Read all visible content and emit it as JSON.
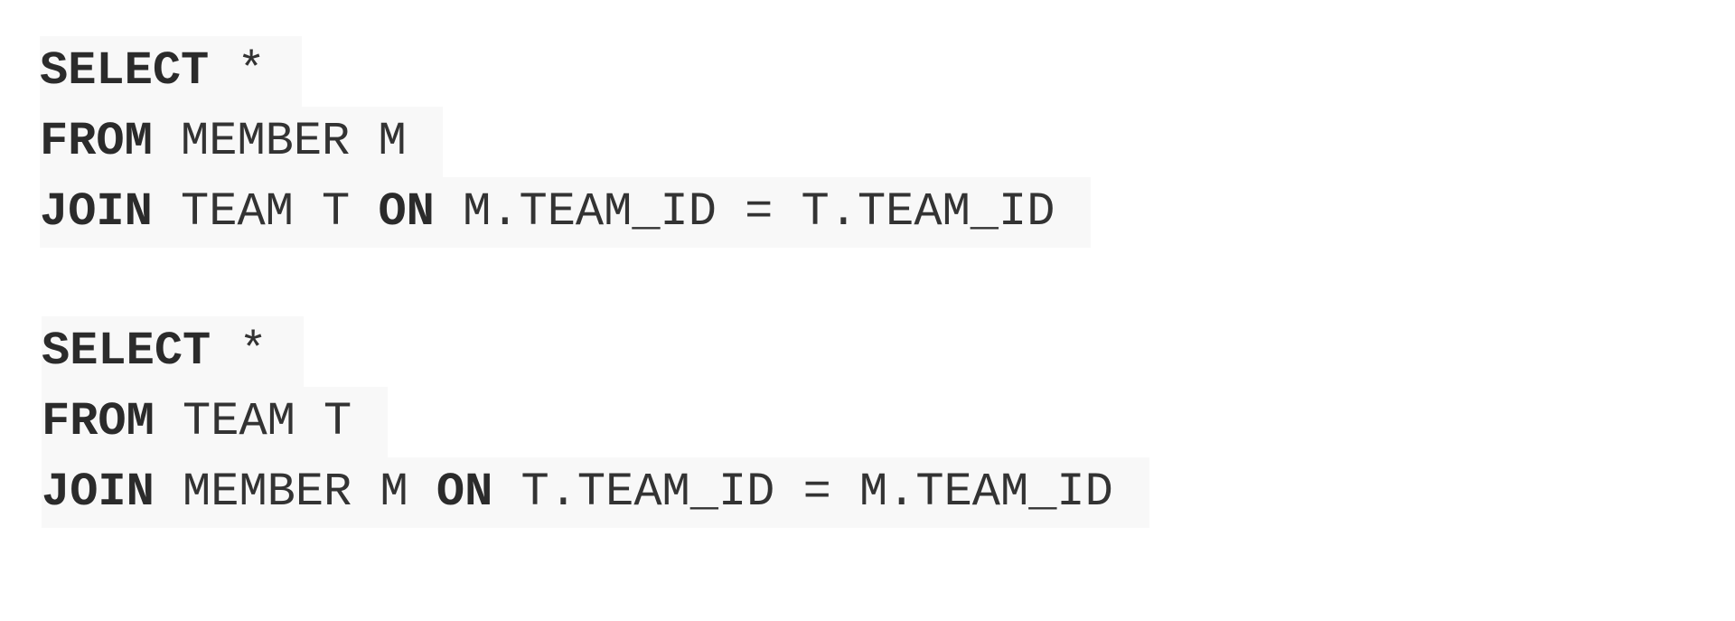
{
  "queries": [
    {
      "lines": [
        {
          "kw": "SELECT",
          "rest": " *"
        },
        {
          "kw": "FROM",
          "rest": " MEMBER M"
        },
        {
          "kw": "JOIN",
          "mid": " TEAM T ",
          "kw2": "ON",
          "rest": " M.TEAM_ID = T.TEAM_ID"
        }
      ]
    },
    {
      "lines": [
        {
          "kw": "SELECT",
          "rest": " *"
        },
        {
          "kw": "FROM",
          "rest": " TEAM T"
        },
        {
          "kw": "JOIN",
          "mid": " MEMBER M ",
          "kw2": "ON",
          "rest": " T.TEAM_ID = M.TEAM_ID"
        }
      ]
    }
  ]
}
